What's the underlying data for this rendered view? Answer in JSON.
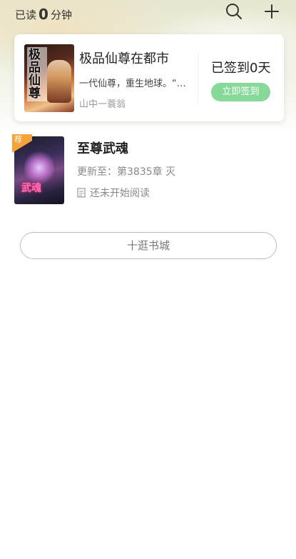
{
  "header": {
    "read_prefix": "已读",
    "read_minutes": "0",
    "read_suffix": "分钟",
    "icons": [
      "search-icon",
      "add-icon"
    ]
  },
  "featured": {
    "cover_text": "极品仙尊",
    "title": "极品仙尊在都市",
    "description": "一代仙尊，重生地球。“…",
    "author": "山中一蓑翁",
    "signin_status": "已签到0天",
    "signin_button": "立即签到",
    "signin_button_color": "#87d99a"
  },
  "shelf": [
    {
      "badge": "荐",
      "cover_text": "武魂",
      "title": "至尊武魂",
      "update": "更新至：第3835章 灭",
      "status": "还未开始阅读"
    }
  ],
  "mall_button": "十逛书城",
  "colors": {
    "badge": "#f6a43a",
    "accent_green": "#87d99a"
  }
}
